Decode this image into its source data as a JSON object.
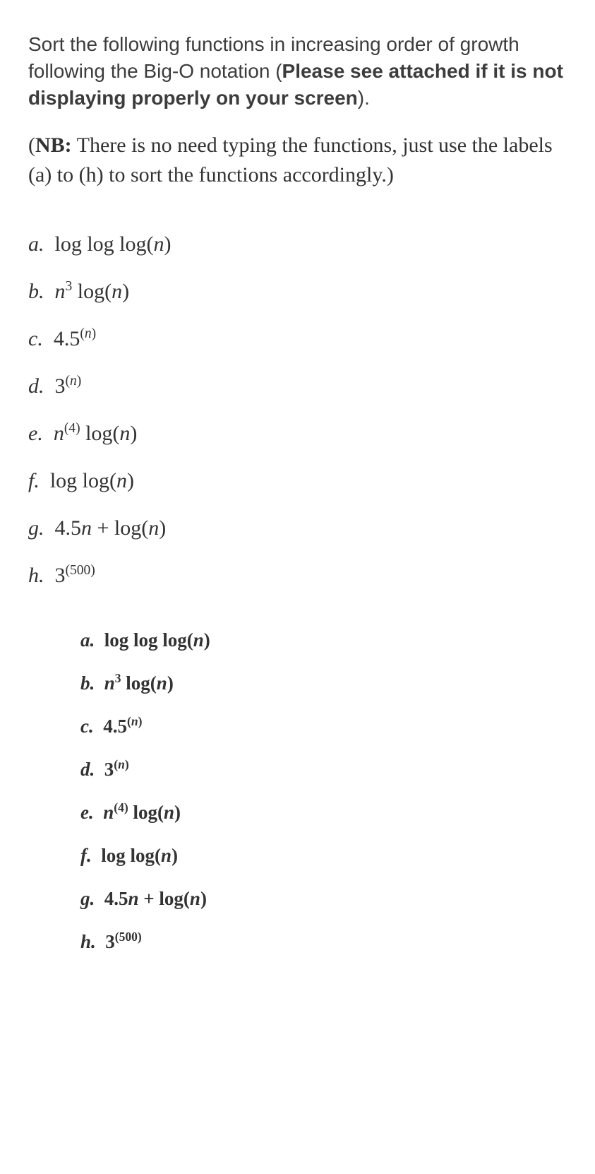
{
  "intro": {
    "plain1": "Sort the following functions in increasing order of growth following the Big-O notation (",
    "bold": "Please see attached if it is not displaying properly on your screen",
    "plain2": ")."
  },
  "nb": {
    "boldLabel": "NB:",
    "text": " There is no need typing the functions, just use the labels (a) to (h) to sort the functions accordingly.)"
  },
  "items": [
    {
      "label": "a.",
      "pre": "log log log(",
      "var": "n",
      "post": ")"
    },
    {
      "label": "b.",
      "nExp": "3",
      "mid": " log(",
      "var": "n",
      "post": ")"
    },
    {
      "label": "c.",
      "num": "4.5",
      "supOpen": "(",
      "supVar": "n",
      "supClose": ")"
    },
    {
      "label": "d.",
      "num": "3",
      "supOpen": "(",
      "supVar": "n",
      "supClose": ")"
    },
    {
      "label": "e.",
      "nSupOpen": "(4)",
      "mid": " log(",
      "var": "n",
      "post": ")"
    },
    {
      "label": "f.",
      "pre": "log log(",
      "var": "n",
      "post": ")"
    },
    {
      "label": "g.",
      "num": "4.5",
      "var1": "n",
      "plus": " + log(",
      "var": "n",
      "post": ")"
    },
    {
      "label": "h.",
      "num": "3",
      "supOpen": "(500)"
    }
  ],
  "items2": [
    {
      "label": "a.",
      "pre": "log log log(",
      "var": "n",
      "post": ")"
    },
    {
      "label": "b.",
      "nExp": "3",
      "mid": " log(",
      "var": "n",
      "post": ")"
    },
    {
      "label": "c.",
      "num": "4.5",
      "supOpen": "(",
      "supVar": "n",
      "supClose": ")"
    },
    {
      "label": "d.",
      "num": "3",
      "supOpen": "(",
      "supVar": "n",
      "supClose": ")"
    },
    {
      "label": "e.",
      "nSupOpen": "(4)",
      "mid": " log(",
      "var": "n",
      "post": ")"
    },
    {
      "label": "f.",
      "pre": "log log(",
      "var": "n",
      "post": ")"
    },
    {
      "label": "g.",
      "num": "4.5",
      "var1": "n",
      "plus": " + log(",
      "var": "n",
      "post": ")"
    },
    {
      "label": "h.",
      "num": "3",
      "supOpen": "(500)"
    }
  ]
}
